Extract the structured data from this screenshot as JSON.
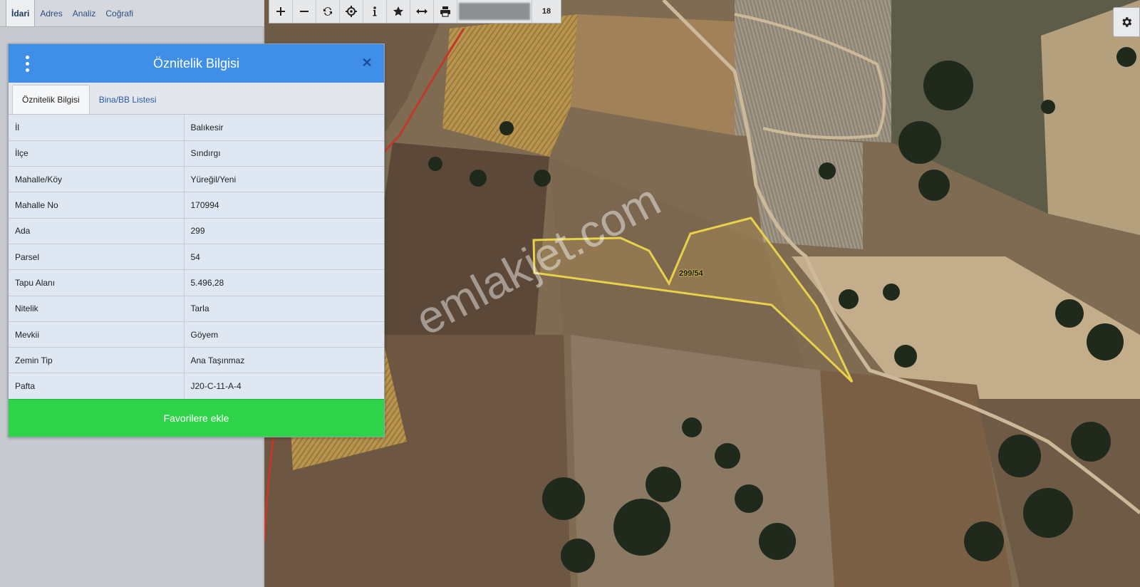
{
  "top_tabs": [
    {
      "label": "İdari",
      "active": true
    },
    {
      "label": "Adres",
      "active": false
    },
    {
      "label": "Analiz",
      "active": false
    },
    {
      "label": "Coğrafi",
      "active": false
    }
  ],
  "toolbar": {
    "buttons": [
      {
        "icon": "zoom-in-icon",
        "name": "zoom-in-button"
      },
      {
        "icon": "zoom-out-icon",
        "name": "zoom-out-button"
      },
      {
        "icon": "refresh-icon",
        "name": "refresh-button"
      },
      {
        "icon": "locate-icon",
        "name": "locate-button"
      },
      {
        "icon": "info-icon",
        "name": "info-button"
      },
      {
        "icon": "star-icon",
        "name": "favorite-button"
      },
      {
        "icon": "measure-icon",
        "name": "measure-button"
      },
      {
        "icon": "print-icon",
        "name": "print-button"
      }
    ],
    "zoom_level": "18"
  },
  "dialog": {
    "title": "Öznitelik Bilgisi",
    "tabs": [
      {
        "label": "Öznitelik Bilgisi",
        "active": true
      },
      {
        "label": "Bina/BB Listesi",
        "active": false
      }
    ],
    "rows": [
      {
        "key": "İl",
        "value": "Balıkesir"
      },
      {
        "key": "İlçe",
        "value": "Sındırgı"
      },
      {
        "key": "Mahalle/Köy",
        "value": "Yüreğil/Yeni"
      },
      {
        "key": "Mahalle No",
        "value": "170994"
      },
      {
        "key": "Ada",
        "value": "299"
      },
      {
        "key": "Parsel",
        "value": "54"
      },
      {
        "key": "Tapu Alanı",
        "value": "5.496,28"
      },
      {
        "key": "Nitelik",
        "value": "Tarla"
      },
      {
        "key": "Mevkii",
        "value": "Göyem"
      },
      {
        "key": "Zemin Tip",
        "value": "Ana Taşınmaz"
      },
      {
        "key": "Pafta",
        "value": "J20-C-11-A-4"
      }
    ],
    "favorite_label": "Favorilere ekle"
  },
  "map": {
    "parcel_label": "299/54",
    "watermark": "emlakjet.com",
    "parcel_color": "#e8d24a"
  },
  "colors": {
    "header_blue": "#3f8ee8",
    "favorite_green": "#2fd34a"
  }
}
